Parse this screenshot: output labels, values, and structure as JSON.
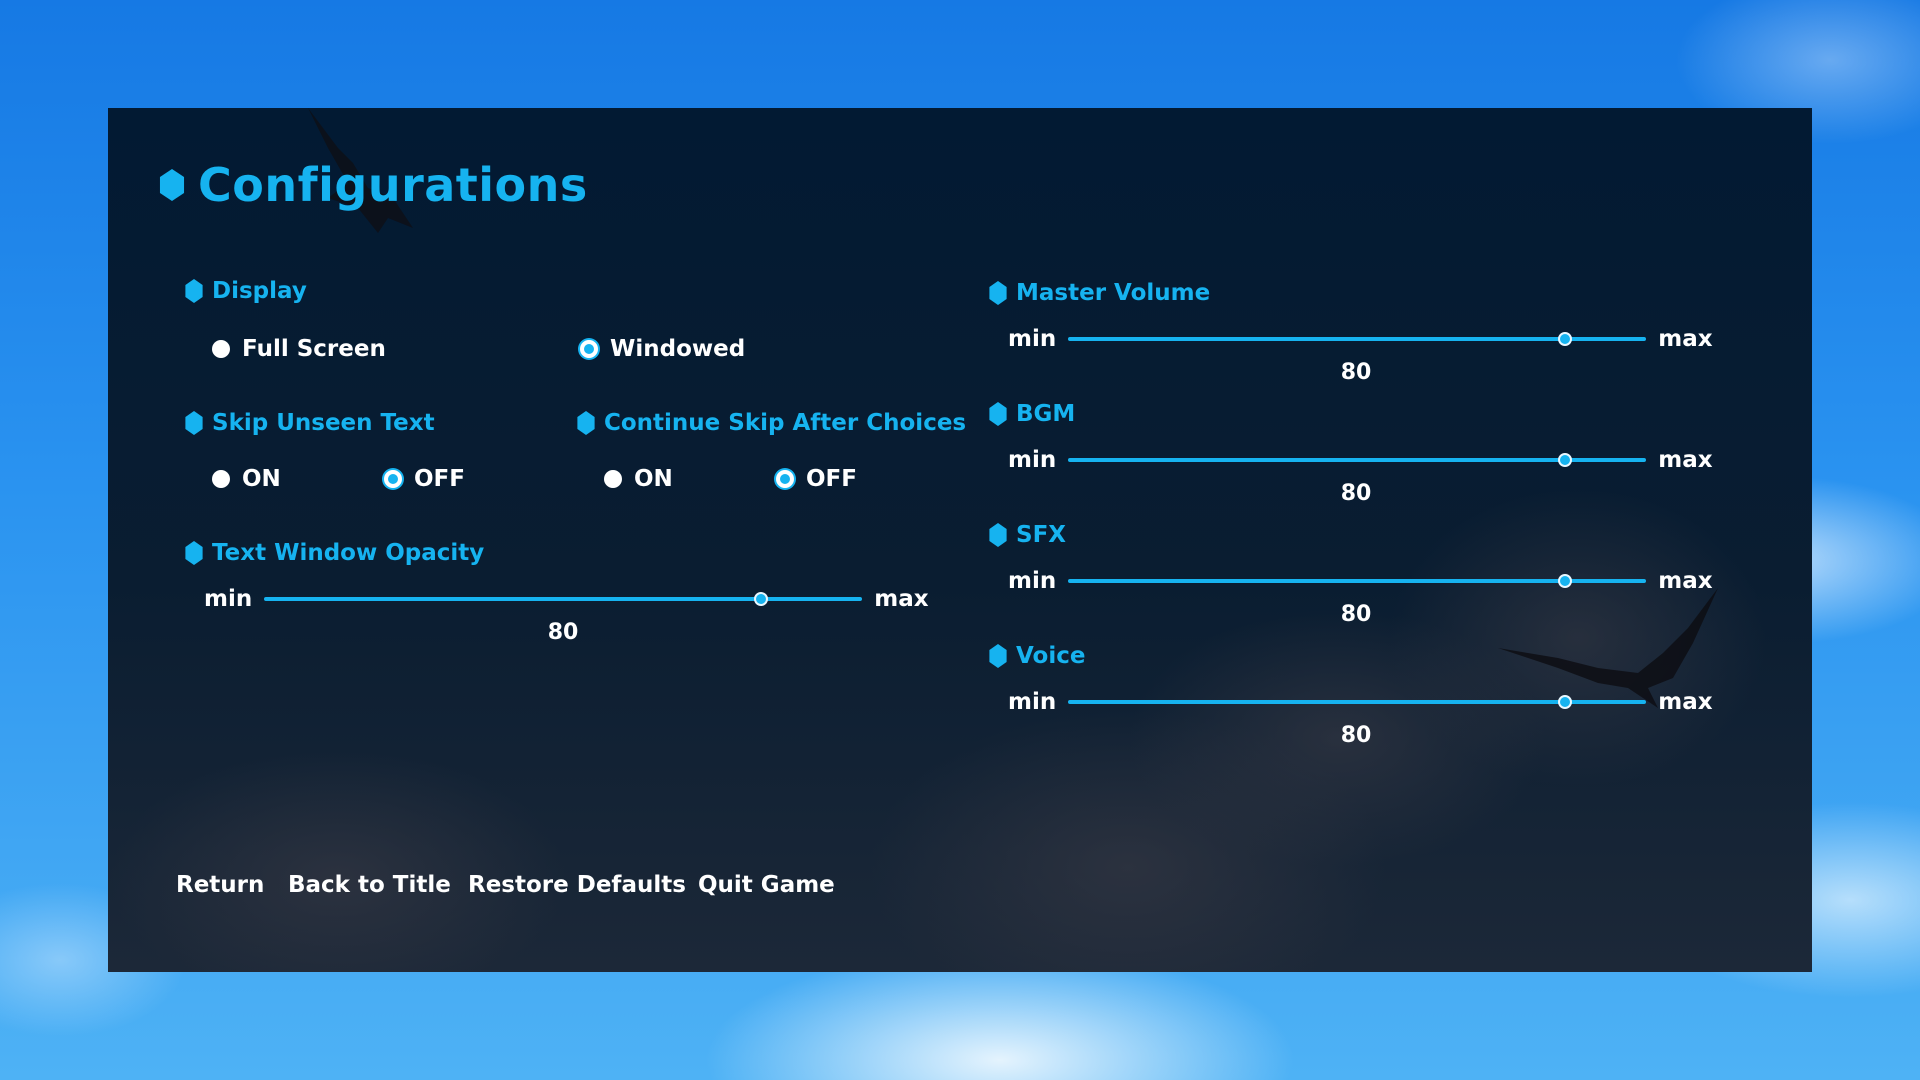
{
  "title": "Configurations",
  "display": {
    "label": "Display",
    "options": [
      "Full Screen",
      "Windowed"
    ],
    "selected": "Windowed"
  },
  "skip_unseen": {
    "label": "Skip Unseen Text",
    "options": [
      "ON",
      "OFF"
    ],
    "selected": "OFF"
  },
  "continue_skip": {
    "label": "Continue Skip After Choices",
    "options": [
      "ON",
      "OFF"
    ],
    "selected": "OFF"
  },
  "text_opacity": {
    "label": "Text Window Opacity",
    "min_label": "min",
    "max_label": "max",
    "value": "80",
    "fraction": 0.83
  },
  "master_volume": {
    "label": "Master Volume",
    "min_label": "min",
    "max_label": "max",
    "value": "80",
    "fraction": 0.86
  },
  "bgm": {
    "label": "BGM",
    "min_label": "min",
    "max_label": "max",
    "value": "80",
    "fraction": 0.86
  },
  "sfx": {
    "label": "SFX",
    "min_label": "min",
    "max_label": "max",
    "value": "80",
    "fraction": 0.86
  },
  "voice": {
    "label": "Voice",
    "min_label": "min",
    "max_label": "max",
    "value": "80",
    "fraction": 0.86
  },
  "footer": {
    "return": "Return",
    "back_to_title": "Back to Title",
    "restore_defaults": "Restore Defaults",
    "quit_game": "Quit Game"
  },
  "colors": {
    "accent": "#16b3f0",
    "panel": "#0a1d31",
    "text": "#ffffff"
  }
}
